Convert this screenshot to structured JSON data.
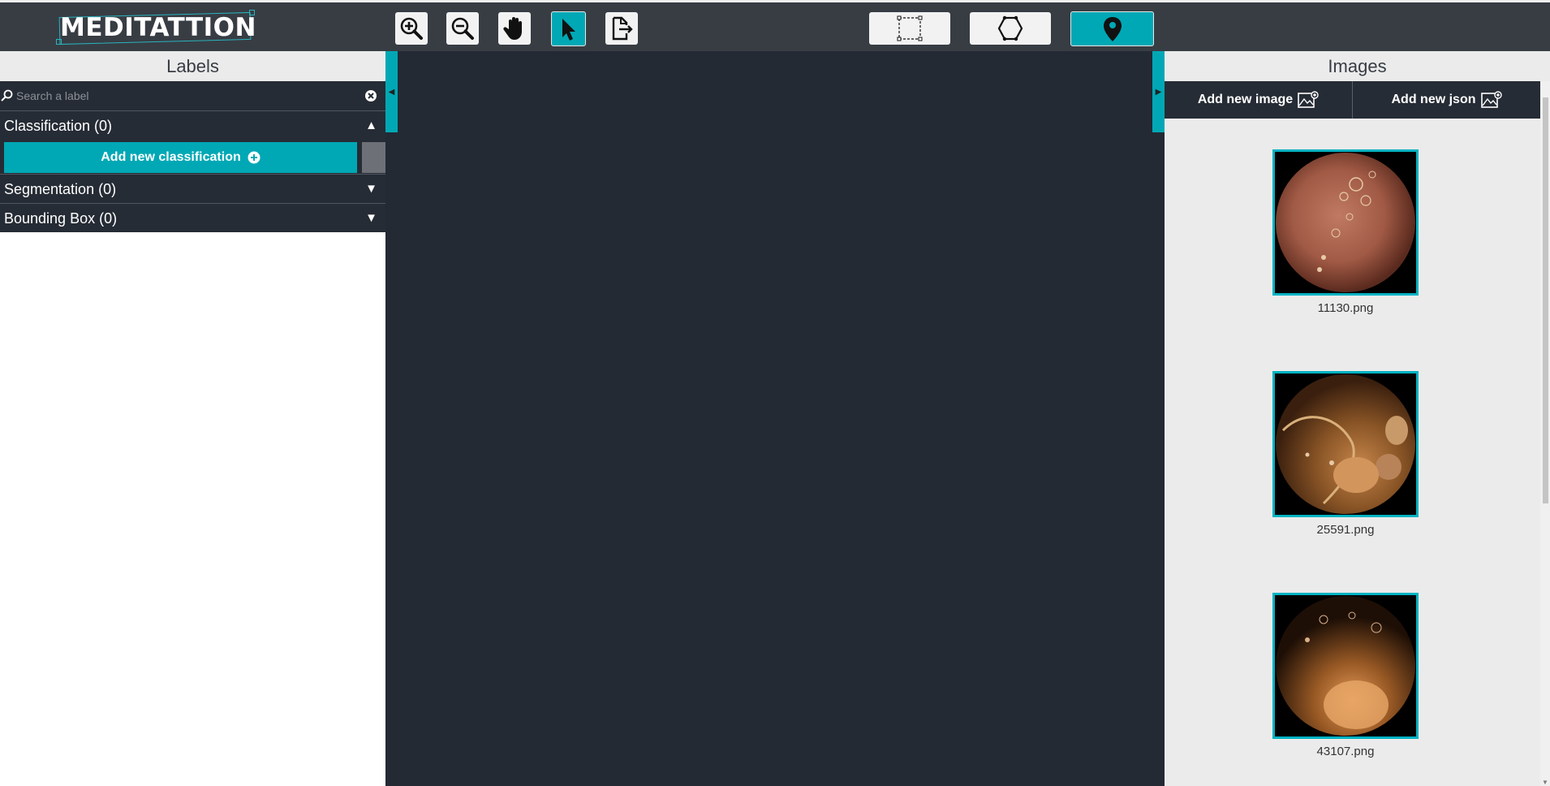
{
  "app": {
    "logo_text": "MEDITATTION"
  },
  "toolbar": {
    "tools": [
      {
        "name": "zoom-in",
        "icon": "zoom-in-icon"
      },
      {
        "name": "zoom-out",
        "icon": "zoom-out-icon"
      },
      {
        "name": "pan",
        "icon": "hand-icon"
      },
      {
        "name": "select",
        "icon": "cursor-icon",
        "active": true
      },
      {
        "name": "export",
        "icon": "export-icon"
      }
    ],
    "shapes": [
      {
        "name": "rectangle",
        "icon": "rectangle-icon"
      },
      {
        "name": "polygon",
        "icon": "polygon-icon"
      },
      {
        "name": "point",
        "icon": "map-pin-icon",
        "active": true
      }
    ]
  },
  "labels_panel": {
    "title": "Labels",
    "search_placeholder": "Search a label",
    "sections": {
      "classification": "Classification (0)",
      "segmentation": "Segmentation (0)",
      "bounding_box": "Bounding Box (0)"
    },
    "add_classification_label": "Add new classification"
  },
  "images_panel": {
    "title": "Images",
    "add_image_label": "Add new image",
    "add_json_label": "Add new json",
    "images": [
      {
        "name": "11130.png"
      },
      {
        "name": "25591.png"
      },
      {
        "name": "43107.png"
      }
    ]
  },
  "colors": {
    "accent": "#00a8b5",
    "toolbar_bg": "#383d44",
    "panel_dark": "#262c35",
    "canvas_bg": "#232a34"
  }
}
